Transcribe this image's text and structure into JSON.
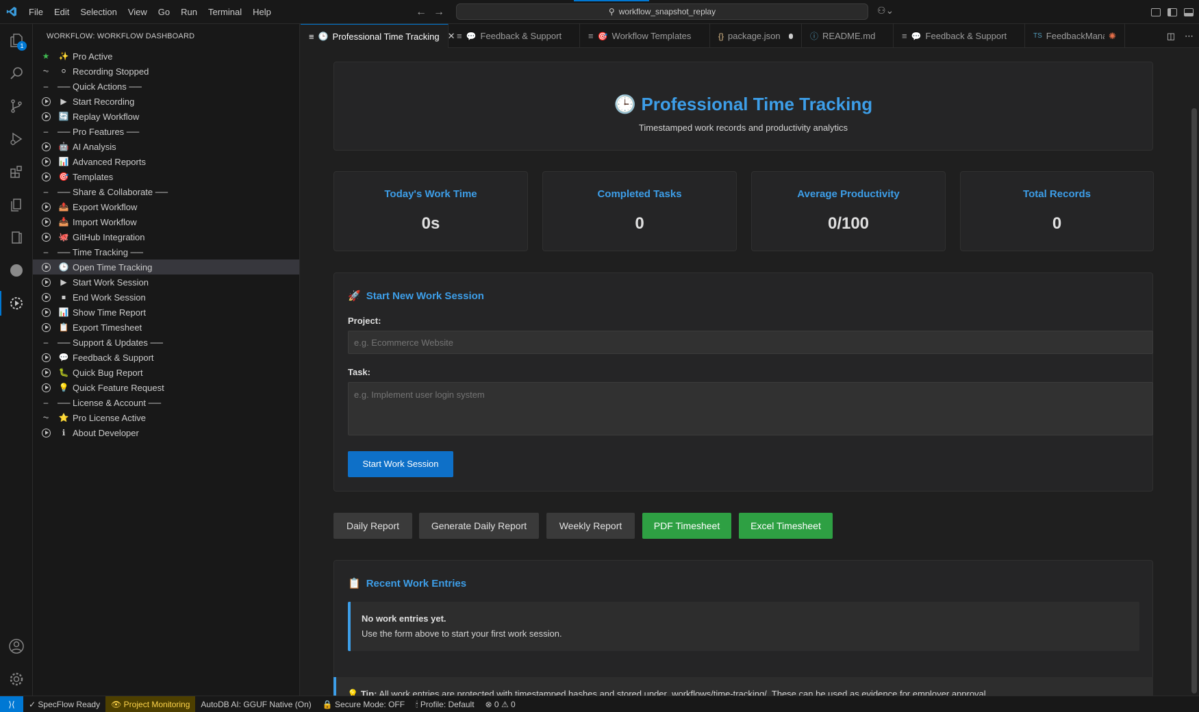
{
  "menu": [
    "File",
    "Edit",
    "Selection",
    "View",
    "Go",
    "Run",
    "Terminal",
    "Help"
  ],
  "search": {
    "text": "workflow_snapshot_replay"
  },
  "activity_badge": "1",
  "sidebar": {
    "title": "WORKFLOW: WORKFLOW DASHBOARD",
    "items": [
      {
        "label": "Pro Active",
        "lead": "star",
        "icon": "✨"
      },
      {
        "label": "Recording Stopped",
        "lead": "pulse",
        "icon": "⚪"
      },
      {
        "label": "── Quick Actions ──",
        "lead": "dash",
        "icon": ""
      },
      {
        "label": "Start Recording",
        "lead": "play",
        "icon": "▶"
      },
      {
        "label": "Replay Workflow",
        "lead": "play",
        "icon": "🔄"
      },
      {
        "label": "── Pro Features ──",
        "lead": "dash",
        "icon": ""
      },
      {
        "label": "AI Analysis",
        "lead": "play",
        "icon": "🤖"
      },
      {
        "label": "Advanced Reports",
        "lead": "play",
        "icon": "📊"
      },
      {
        "label": "Templates",
        "lead": "play",
        "icon": "🎯"
      },
      {
        "label": "── Share & Collaborate ──",
        "lead": "dash",
        "icon": ""
      },
      {
        "label": "Export Workflow",
        "lead": "play",
        "icon": "📤"
      },
      {
        "label": "Import Workflow",
        "lead": "play",
        "icon": "📥"
      },
      {
        "label": "GitHub Integration",
        "lead": "play",
        "icon": "🐙"
      },
      {
        "label": "── Time Tracking ──",
        "lead": "dash",
        "icon": ""
      },
      {
        "label": "Open Time Tracking",
        "lead": "play",
        "icon": "🕒"
      },
      {
        "label": "Start Work Session",
        "lead": "play",
        "icon": "▶"
      },
      {
        "label": "End Work Session",
        "lead": "play",
        "icon": "⏹"
      },
      {
        "label": "Show Time Report",
        "lead": "play",
        "icon": "📊"
      },
      {
        "label": "Export Timesheet",
        "lead": "play",
        "icon": "📋"
      },
      {
        "label": "── Support & Updates ──",
        "lead": "dash",
        "icon": ""
      },
      {
        "label": "Feedback & Support",
        "lead": "play",
        "icon": "💬"
      },
      {
        "label": "Quick Bug Report",
        "lead": "play",
        "icon": "🐛"
      },
      {
        "label": "Quick Feature Request",
        "lead": "play",
        "icon": "💡"
      },
      {
        "label": "── License & Account ──",
        "lead": "dash",
        "icon": ""
      },
      {
        "label": "Pro License Active",
        "lead": "pulse",
        "icon": "⭐"
      },
      {
        "label": "About Developer",
        "lead": "play",
        "icon": "ℹ"
      }
    ],
    "selected_index": 14
  },
  "tabs": [
    {
      "label": "Professional Time Tracking",
      "icon": "🕒",
      "kind": "preview",
      "active": true,
      "state": "close"
    },
    {
      "label": "Feedback & Support",
      "icon": "💬",
      "kind": "preview",
      "active": false,
      "state": ""
    },
    {
      "label": "Workflow Templates",
      "icon": "🎯",
      "kind": "preview",
      "active": false,
      "state": ""
    },
    {
      "label": "package.json",
      "icon": "{}",
      "kind": "json",
      "active": false,
      "state": "dirty"
    },
    {
      "label": "README.md",
      "icon": "ⓘ",
      "kind": "md",
      "active": false,
      "state": ""
    },
    {
      "label": "Feedback & Support",
      "icon": "💬",
      "kind": "preview",
      "active": false,
      "state": ""
    },
    {
      "label": "FeedbackManag",
      "icon": "TS",
      "kind": "ts",
      "active": false,
      "state": ""
    }
  ],
  "page": {
    "title": "Professional Time Tracking",
    "subtitle": "Timestamped work records and productivity analytics",
    "stats": [
      {
        "label": "Today's Work Time",
        "value": "0s"
      },
      {
        "label": "Completed Tasks",
        "value": "0"
      },
      {
        "label": "Average Productivity",
        "value": "0/100"
      },
      {
        "label": "Total Records",
        "value": "0"
      }
    ],
    "session": {
      "title": "Start New Work Session",
      "project_label": "Project:",
      "project_placeholder": "e.g. Ecommerce Website",
      "task_label": "Task:",
      "task_placeholder": "e.g. Implement user login system",
      "start_button": "Start Work Session"
    },
    "report_buttons": {
      "daily": "Daily Report",
      "generate_daily": "Generate Daily Report",
      "weekly": "Weekly Report",
      "pdf": "PDF Timesheet",
      "excel": "Excel Timesheet"
    },
    "recent": {
      "title": "Recent Work Entries",
      "empty_title": "No work entries yet.",
      "empty_text": "Use the form above to start your first work session."
    },
    "tip": {
      "label": "Tip:",
      "text": "All work entries are protected with timestamped hashes and stored under .workflows/time-tracking/. These can be used as evidence for employer approval."
    }
  },
  "statusbar": {
    "items": [
      {
        "label": "✓ SpecFlow Ready",
        "style": "normal"
      },
      {
        "label": "👁 Project Monitoring",
        "style": "warn"
      },
      {
        "label": "AutoDB AI: GGUF Native (On)",
        "style": "normal"
      },
      {
        "label": "🔒 Secure Mode: OFF",
        "style": "normal"
      },
      {
        "label": "🕯 Profile: Default",
        "style": "normal"
      },
      {
        "label": "⊗ 0 ⚠ 0",
        "style": "normal"
      }
    ]
  },
  "colors": {
    "accent": "#3d9ee8",
    "primary_button": "#0e70c8",
    "success_button": "#2ea043",
    "status_remote": "#0078d4"
  }
}
